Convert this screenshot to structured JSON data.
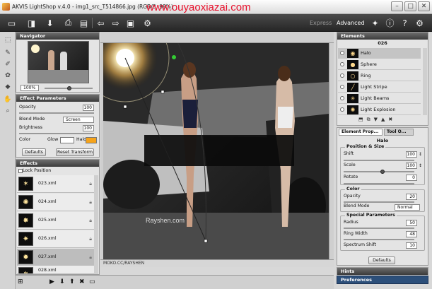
{
  "window": {
    "title": "AKVIS LightShop v.4.0 - img1_src_T514866.jpg (RGB/8, 98%)",
    "watermark": "www.ouyaoxiazai.com",
    "buttons": [
      "–",
      "□",
      "✕"
    ]
  },
  "toolbar": {
    "icons": [
      "open-icon",
      "save-icon",
      "download-icon",
      "print-icon",
      "undo-icon",
      "redo-icon",
      "before-after-icon",
      "settings-icon",
      "run-icon"
    ],
    "modes": {
      "express": "Express",
      "advanced": "Advanced"
    },
    "right_icons": [
      "light-bulb-icon",
      "info-icon",
      "help-icon",
      "gear-icon"
    ]
  },
  "navigator": {
    "title": "Navigator",
    "zoom": "100%"
  },
  "effect_params": {
    "title": "Effect Parameters",
    "opacity_label": "Opacity",
    "opacity": "100",
    "blend_mode_label": "Blend Mode",
    "blend_mode": "Screen",
    "brightness_label": "Brightness",
    "brightness": "100",
    "color_label": "Color",
    "glow_label": "Glow",
    "halo_label": "Halo",
    "defaults_label": "Defaults",
    "reset_label": "Reset Transform"
  },
  "effects": {
    "title": "Effects",
    "lock_label": "Lock Position",
    "items": [
      "023.xml",
      "024.xml",
      "025.xml",
      "026.xml",
      "027.xml",
      "028.xml"
    ]
  },
  "canvas": {
    "watermark_text": "Rayshen.com",
    "footer_text": "MOKO.CC/RAYSHEN"
  },
  "elements": {
    "title": "Elements",
    "count": "026",
    "items": [
      "Halo",
      "Sphere",
      "Ring",
      "Light Stripe",
      "Light Beams",
      "Light Explosion"
    ]
  },
  "element_props": {
    "tab1": "Element Prop...",
    "tab2": "Tool O...",
    "element_name": "Halo",
    "position_group": "Position & Size",
    "shift_label": "Shift",
    "shift": "100",
    "scale_label": "Scale",
    "scale": "100",
    "rotate_label": "Rotate",
    "rotate": "0",
    "color_group": "Color",
    "opacity_label": "Opacity",
    "opacity": "20",
    "blend_label": "Blend Mode",
    "blend_mode": "Normal",
    "special_group": "Special Parameters",
    "radius_label": "Radius",
    "radius": "50",
    "ring_width_label": "Ring Width",
    "ring_width": "48",
    "spectrum_label": "Spectrum Shift",
    "spectrum": "10",
    "defaults_label": "Defaults"
  },
  "bottom_right": {
    "hints": "Hints",
    "preferences": "Preferences"
  },
  "colors": {
    "toolbar": "#2f2f2f",
    "panel_header": "#4a4a4a",
    "watermark_red": "#e8112c",
    "halo_color": "#f6a31a"
  }
}
